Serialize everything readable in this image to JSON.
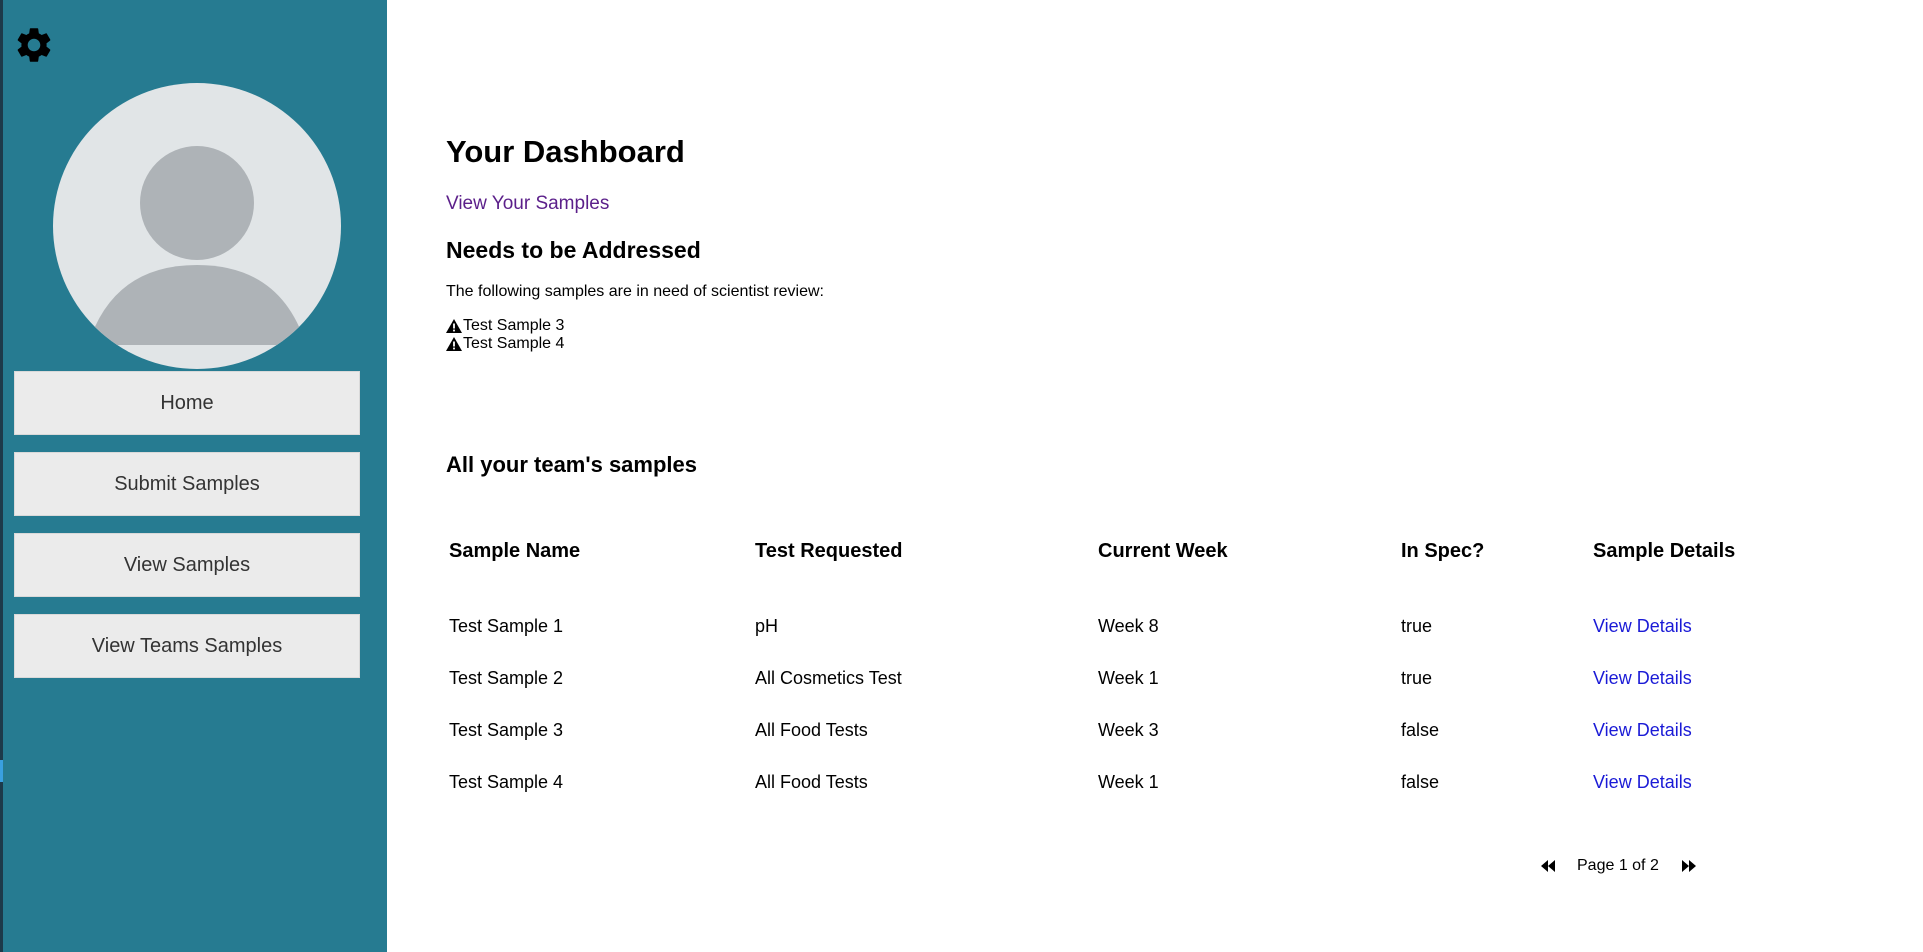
{
  "sidebar": {
    "nav": [
      {
        "label": "Home"
      },
      {
        "label": "Submit Samples"
      },
      {
        "label": "View Samples"
      },
      {
        "label": "View Teams Samples"
      }
    ]
  },
  "dashboard": {
    "title": "Your Dashboard",
    "view_link": "View Your Samples",
    "needs_heading": "Needs to be Addressed",
    "needs_text": "The following samples are in need of scientist review:",
    "flagged": [
      "Test Sample 3",
      "Test Sample 4"
    ],
    "team_heading": "All your team's samples"
  },
  "table": {
    "headers": [
      "Sample Name",
      "Test Requested",
      "Current Week",
      "In Spec?",
      "Sample Details"
    ],
    "rows": [
      {
        "name": "Test Sample 1",
        "test": "pH",
        "week": "Week 8",
        "spec": "true",
        "details": "View Details"
      },
      {
        "name": "Test Sample 2",
        "test": "All Cosmetics Test",
        "week": "Week 1",
        "spec": "true",
        "details": "View Details"
      },
      {
        "name": "Test Sample 3",
        "test": "All Food Tests",
        "week": "Week 3",
        "spec": "false",
        "details": "View Details"
      },
      {
        "name": "Test Sample 4",
        "test": "All Food Tests",
        "week": "Week 1",
        "spec": "false",
        "details": "View Details"
      }
    ]
  },
  "pagination": {
    "label": "Page 1 of 2"
  },
  "icons": {
    "settings": "gear-icon",
    "avatar": "user-avatar-placeholder",
    "alert": "warning-icon",
    "prev": "double-chevron-left-icon",
    "next": "double-chevron-right-icon"
  },
  "colors": {
    "sidebar_bg": "#267b91",
    "nav_button_bg": "#ebebeb",
    "visited_link": "#5b1f8a",
    "link": "#1a1ad6"
  }
}
